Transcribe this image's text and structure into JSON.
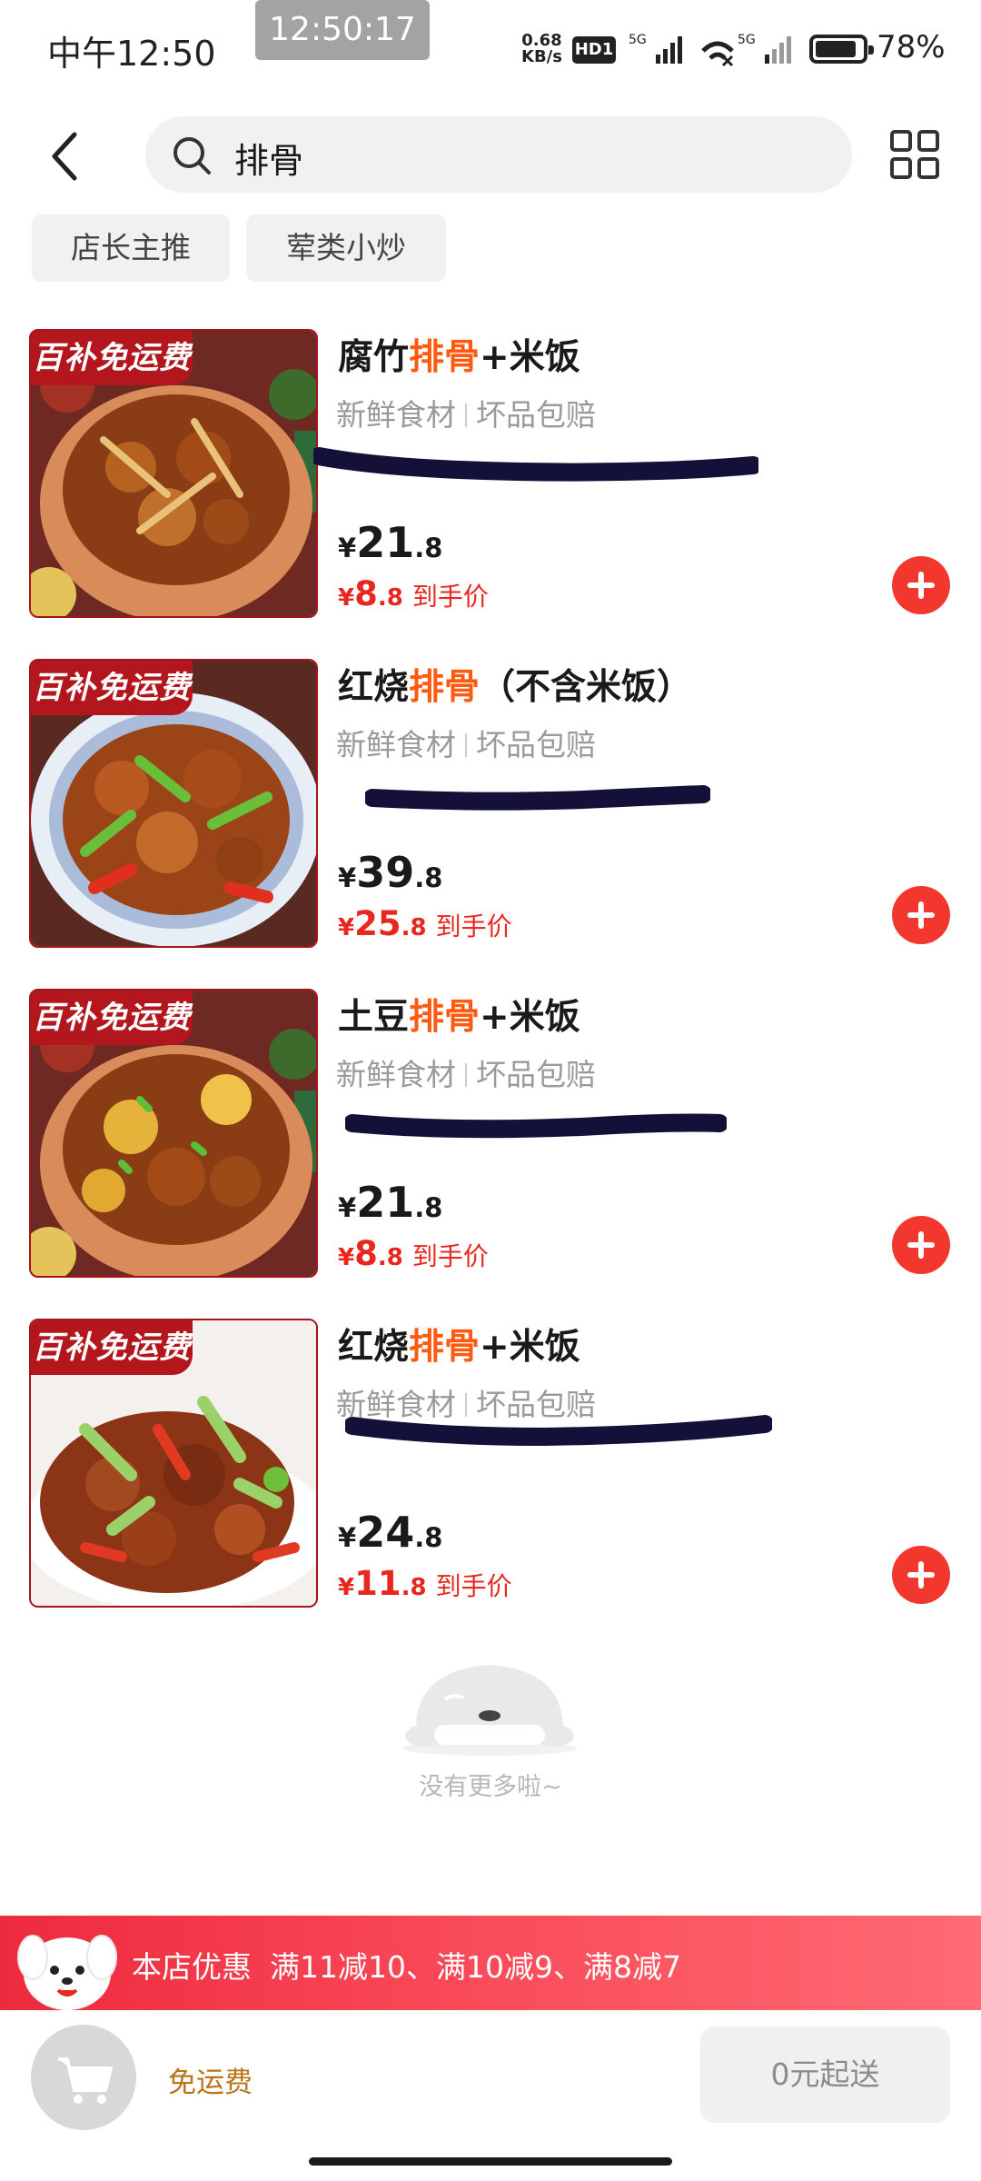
{
  "status_bar": {
    "time": "中午12:50",
    "overlay_time": "12:50:17",
    "net_speed_value": "0.68",
    "net_speed_unit": "KB/s",
    "hd_badge": "HD1",
    "signal_1_label": "5G",
    "signal_2_label": "5G",
    "battery": "78%"
  },
  "header": {
    "back_icon": "chevron-left-icon",
    "search_icon": "search-icon",
    "search_query": "排骨",
    "grid_icon": "grid-icon"
  },
  "tags": [
    {
      "label": "店长主推"
    },
    {
      "label": "荤类小炒"
    }
  ],
  "products": [
    {
      "badge": "百补免运费",
      "name_prefix": "腐竹",
      "name_highlight": "排骨",
      "name_suffix": "+米饭",
      "feature_1": "新鲜食材",
      "feature_2": "坏品包赔",
      "currency": "¥",
      "price_int": "21",
      "price_dec": ".8",
      "final_int": "8",
      "final_dec": ".8",
      "final_label": "到手价"
    },
    {
      "badge": "百补免运费",
      "name_prefix": "红烧",
      "name_highlight": "排骨",
      "name_suffix": "（不含米饭）",
      "feature_1": "新鲜食材",
      "feature_2": "坏品包赔",
      "currency": "¥",
      "price_int": "39",
      "price_dec": ".8",
      "final_int": "25",
      "final_dec": ".8",
      "final_label": "到手价"
    },
    {
      "badge": "百补免运费",
      "name_prefix": "土豆",
      "name_highlight": "排骨",
      "name_suffix": "+米饭",
      "feature_1": "新鲜食材",
      "feature_2": "坏品包赔",
      "currency": "¥",
      "price_int": "21",
      "price_dec": ".8",
      "final_int": "8",
      "final_dec": ".8",
      "final_label": "到手价"
    },
    {
      "badge": "百补免运费",
      "name_prefix": "红烧",
      "name_highlight": "排骨",
      "name_suffix": "+米饭",
      "feature_1": "新鲜食材",
      "feature_2": "坏品包赔",
      "currency": "¥",
      "price_int": "24",
      "price_dec": ".8",
      "final_int": "11",
      "final_dec": ".8",
      "final_label": "到手价"
    }
  ],
  "list_end": {
    "text": "没有更多啦~"
  },
  "promo": {
    "shop_label": "本店优惠",
    "offers": "满11减10、满10减9、满8减7"
  },
  "bottom": {
    "cart_icon": "cart-icon",
    "delivery": "免运费",
    "min_order": "0元起送"
  },
  "colors": {
    "highlight": "#ff5a12",
    "final_price": "#e8271f",
    "add_button": "#f2372f",
    "promo_bar": "#ee2a3e",
    "badge": "#b3161c"
  }
}
